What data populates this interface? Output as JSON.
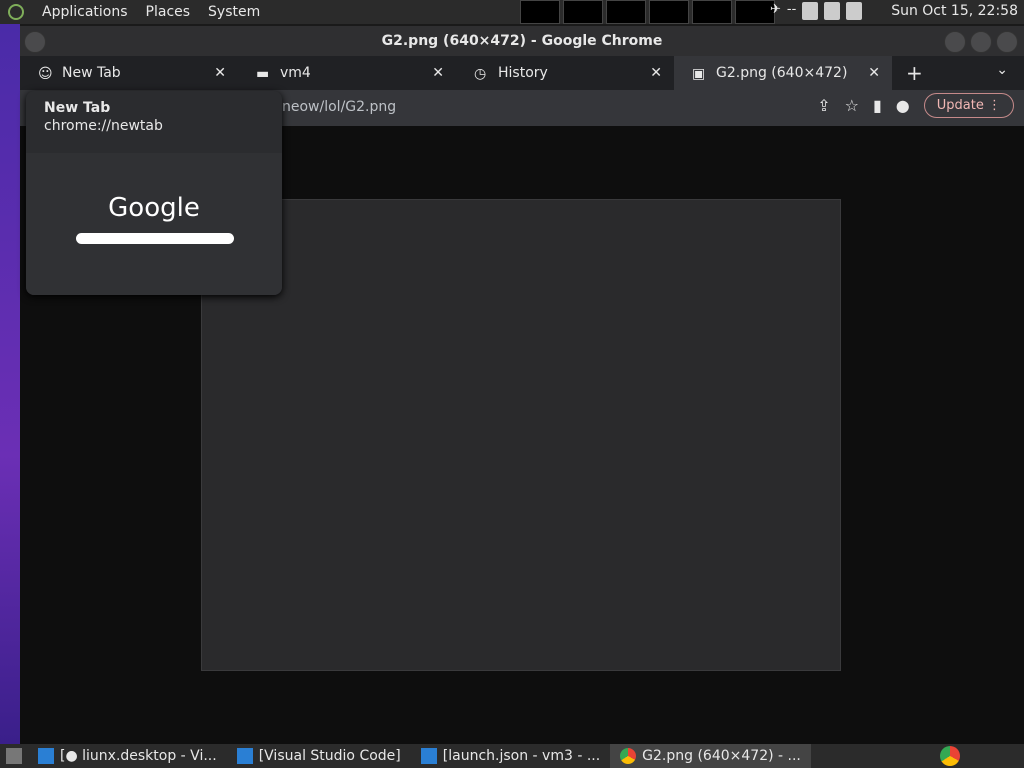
{
  "topbar": {
    "menus": [
      "Applications",
      "Places",
      "System"
    ],
    "clock": "Sun Oct 15, 22:58",
    "tray_text": "--"
  },
  "window": {
    "title": "G2.png (640×472) - Google Chrome"
  },
  "tabs": [
    {
      "label": "New Tab",
      "icon": "newtab-icon"
    },
    {
      "label": "vm4",
      "icon": "folder-icon"
    },
    {
      "label": "History",
      "icon": "history-icon"
    },
    {
      "label": "G2.png (640×472)",
      "icon": "image-favicon"
    }
  ],
  "toolbar": {
    "url": "neow/lol/G2.png",
    "update_label": "Update"
  },
  "hovercard": {
    "title": "New Tab",
    "url": "chrome://newtab",
    "preview_logo": "Google"
  },
  "taskbar": {
    "items": [
      {
        "label": "[● liunx.desktop - Vi...",
        "icon": "vscode-icon"
      },
      {
        "label": "[Visual Studio Code]",
        "icon": "vscode-icon"
      },
      {
        "label": "[launch.json - vm3 - ...",
        "icon": "vscode-icon"
      },
      {
        "label": "G2.png (640×472) - ...",
        "icon": "chrome-icon"
      }
    ]
  },
  "colors": {
    "accent": "#7fae5a",
    "update_border": "#c58a8a"
  }
}
